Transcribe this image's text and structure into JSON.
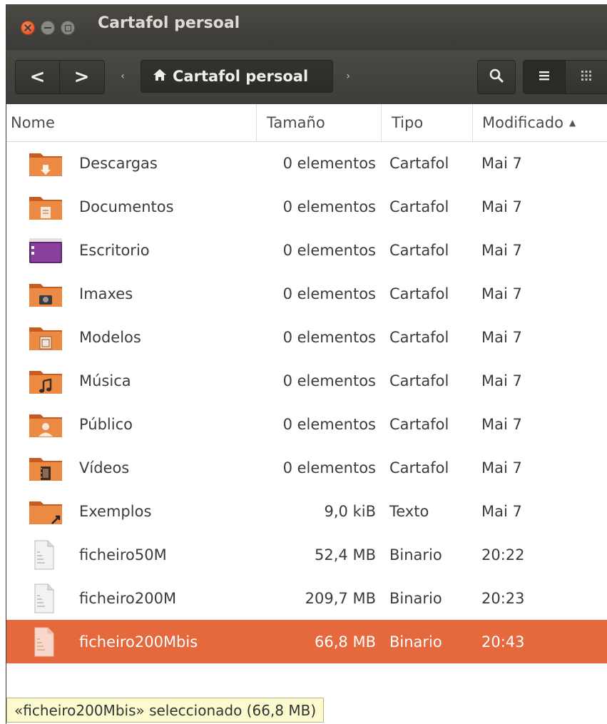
{
  "window": {
    "title": "Cartafol persoal"
  },
  "toolbar": {
    "back_label": "<",
    "forward_label": ">",
    "path_left_arrow": "‹",
    "path_right_arrow": "›",
    "path_current": "Cartafol persoal",
    "home_icon": "home-icon",
    "search_icon": "search-icon",
    "list_view_icon": "list-view-icon",
    "grid_view_icon": "grid-view-icon"
  },
  "columns": {
    "name": "Nome",
    "size": "Tamaño",
    "type": "Tipo",
    "modified": "Modificado",
    "sort_indicator": "▲"
  },
  "rows": [
    {
      "name": "Descargas",
      "size": "0 elementos",
      "type": "Cartafol",
      "modified": "Mai 7",
      "icon": "folder-downloads-icon",
      "selected": false
    },
    {
      "name": "Documentos",
      "size": "0 elementos",
      "type": "Cartafol",
      "modified": "Mai 7",
      "icon": "folder-documents-icon",
      "selected": false
    },
    {
      "name": "Escritorio",
      "size": "0 elementos",
      "type": "Cartafol",
      "modified": "Mai 7",
      "icon": "desktop-folder-icon",
      "selected": false
    },
    {
      "name": "Imaxes",
      "size": "0 elementos",
      "type": "Cartafol",
      "modified": "Mai 7",
      "icon": "folder-pictures-icon",
      "selected": false
    },
    {
      "name": "Modelos",
      "size": "0 elementos",
      "type": "Cartafol",
      "modified": "Mai 7",
      "icon": "folder-templates-icon",
      "selected": false
    },
    {
      "name": "Música",
      "size": "0 elementos",
      "type": "Cartafol",
      "modified": "Mai 7",
      "icon": "folder-music-icon",
      "selected": false
    },
    {
      "name": "Público",
      "size": "0 elementos",
      "type": "Cartafol",
      "modified": "Mai 7",
      "icon": "folder-public-icon",
      "selected": false
    },
    {
      "name": "Vídeos",
      "size": "0 elementos",
      "type": "Cartafol",
      "modified": "Mai 7",
      "icon": "folder-videos-icon",
      "selected": false
    },
    {
      "name": "Exemplos",
      "size": "9,0 kiB",
      "type": "Texto",
      "modified": "Mai 7",
      "icon": "folder-link-icon",
      "selected": false
    },
    {
      "name": "ficheiro50M",
      "size": "52,4 MB",
      "type": "Binario",
      "modified": "20:22",
      "icon": "binary-file-icon",
      "selected": false
    },
    {
      "name": "ficheiro200M",
      "size": "209,7 MB",
      "type": "Binario",
      "modified": "20:23",
      "icon": "binary-file-icon",
      "selected": false
    },
    {
      "name": "ficheiro200Mbis",
      "size": "66,8 MB",
      "type": "Binario",
      "modified": "20:43",
      "icon": "binary-file-icon",
      "selected": true
    }
  ],
  "status": {
    "text": "«ficheiro200Mbis» seleccionado (66,8 MB)"
  },
  "colors": {
    "titlebar": "#3c3b37",
    "selection": "#e6693e",
    "folder": "#e8863f",
    "desktop_folder": "#7e3a8e",
    "status_background": "#fcfbd0"
  }
}
